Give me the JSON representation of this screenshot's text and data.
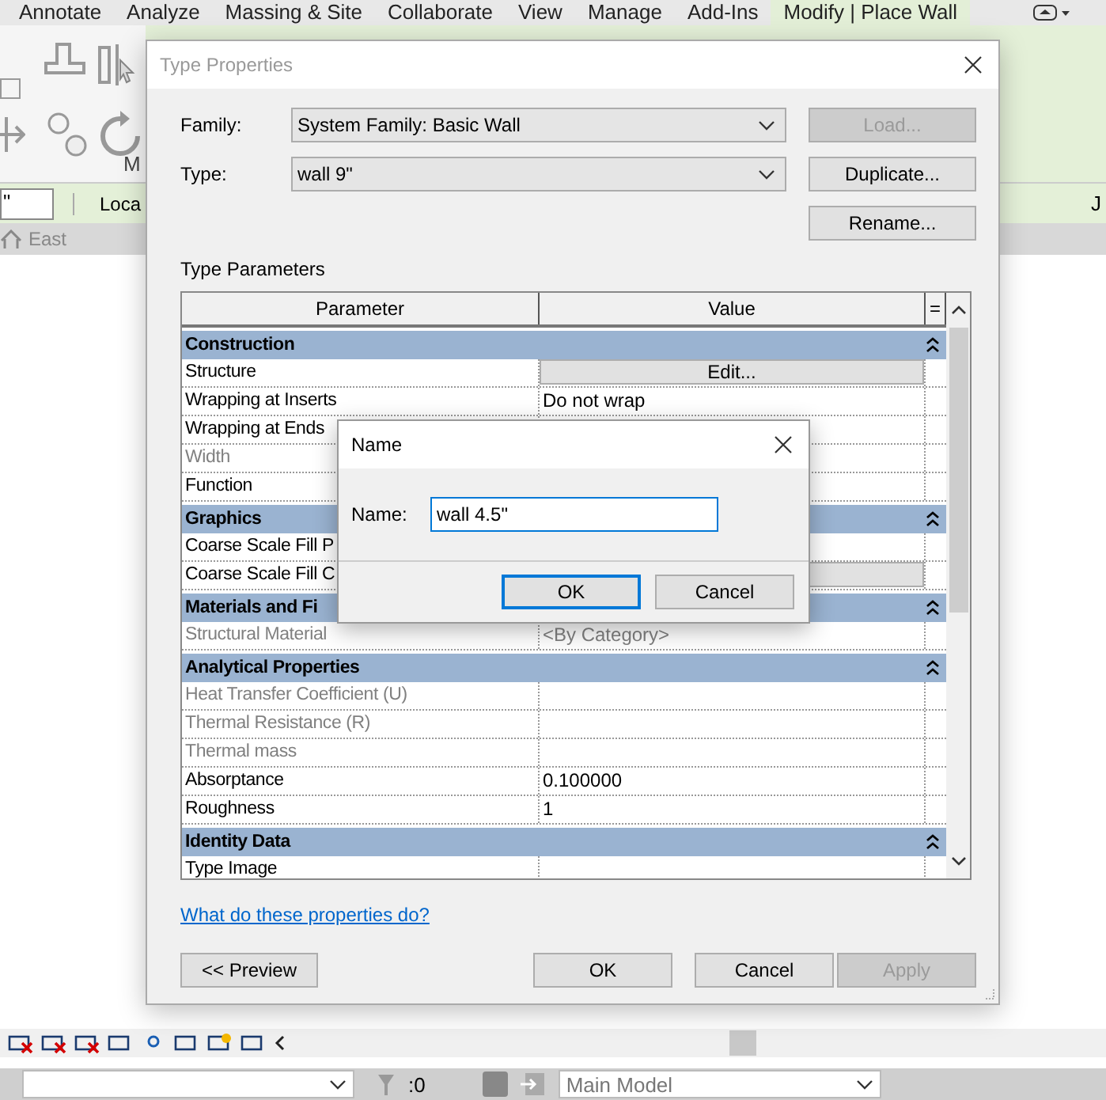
{
  "ribbon_tabs": [
    {
      "label": "Annotate",
      "selected": false
    },
    {
      "label": "Analyze",
      "selected": false
    },
    {
      "label": "Massing & Site",
      "selected": false
    },
    {
      "label": "Collaborate",
      "selected": false
    },
    {
      "label": "View",
      "selected": false
    },
    {
      "label": "Manage",
      "selected": false
    },
    {
      "label": "Add-Ins",
      "selected": false
    },
    {
      "label": "Modify | Place Wall",
      "selected": true
    }
  ],
  "ribbon": {
    "panel_label": "M"
  },
  "options_bar": {
    "field_value": "\"",
    "label": "Loca",
    "right_label": "J"
  },
  "view_tab": {
    "label": "East"
  },
  "status_bar": {
    "selection_count": ":0",
    "model": "Main Model"
  },
  "type_properties": {
    "title": "Type Properties",
    "family_label": "Family:",
    "family": "System Family: Basic Wall",
    "type_label": "Type:",
    "type": "wall 9\"",
    "side_buttons": [
      {
        "label": "Load...",
        "disabled": true
      },
      {
        "label": "Duplicate...",
        "disabled": false
      },
      {
        "label": "Rename...",
        "disabled": false
      }
    ],
    "section_title": "Type Parameters",
    "columns": [
      "Parameter",
      "Value",
      "="
    ],
    "groups": [
      {
        "title": "Construction",
        "expanded": true,
        "rows": [
          {
            "parameter": "Structure",
            "disabled": false,
            "kind": "button",
            "value": "Edit..."
          },
          {
            "parameter": "Wrapping at Inserts",
            "disabled": false,
            "kind": "text",
            "value": "Do not wrap"
          },
          {
            "parameter": "Wrapping at Ends",
            "disabled": false,
            "kind": "text"
          },
          {
            "parameter": "Width",
            "disabled": true,
            "kind": "text"
          },
          {
            "parameter": "Function",
            "disabled": false,
            "kind": "text"
          }
        ]
      },
      {
        "title": "Graphics",
        "expanded": true,
        "rows": [
          {
            "parameter": "Coarse Scale Fill P",
            "disabled": false,
            "kind": "text"
          },
          {
            "parameter": "Coarse Scale Fill C",
            "disabled": false,
            "kind": "button"
          }
        ]
      },
      {
        "title": "Materials and Fi",
        "expanded": true,
        "rows": [
          {
            "parameter": "Structural Material",
            "disabled": true,
            "kind": "text",
            "value": "<By Category>"
          }
        ]
      },
      {
        "title": "Analytical Properties",
        "expanded": true,
        "rows": [
          {
            "parameter": "Heat Transfer Coefficient (U)",
            "disabled": true,
            "kind": "text"
          },
          {
            "parameter": "Thermal Resistance (R)",
            "disabled": true,
            "kind": "text"
          },
          {
            "parameter": "Thermal mass",
            "disabled": true,
            "kind": "text"
          },
          {
            "parameter": "Absorptance",
            "disabled": false,
            "kind": "text",
            "value": "0.100000"
          },
          {
            "parameter": "Roughness",
            "disabled": false,
            "kind": "text",
            "value": "1"
          }
        ]
      },
      {
        "title": "Identity Data",
        "expanded": true,
        "rows": [
          {
            "parameter": "Type Image",
            "disabled": false,
            "kind": "text"
          }
        ]
      }
    ],
    "help_link": "What do these properties do?",
    "preview_button": "<< Preview",
    "buttons": [
      {
        "label": "OK",
        "disabled": false
      },
      {
        "label": "Cancel",
        "disabled": false
      },
      {
        "label": "Apply",
        "disabled": true
      }
    ]
  },
  "name_dialog": {
    "title": "Name",
    "field_label": "Name:",
    "value": "wall 4.5\"",
    "buttons": [
      {
        "label": "OK",
        "default": true
      },
      {
        "label": "Cancel",
        "default": false
      }
    ]
  }
}
